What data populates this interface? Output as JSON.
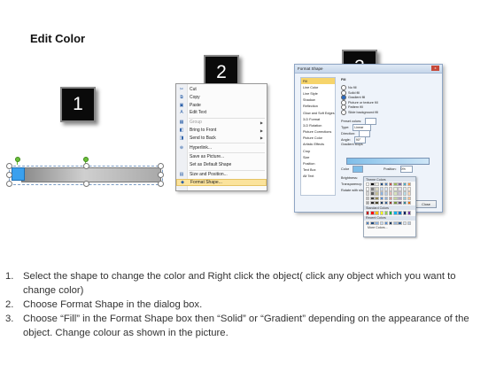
{
  "title": "Edit Color",
  "badges": [
    "1",
    "2",
    "3"
  ],
  "context_menu": {
    "items": [
      {
        "label": "Cut",
        "icon": "cut-icon",
        "glyph": "✂",
        "disabled": false,
        "submenu": false
      },
      {
        "label": "Copy",
        "icon": "copy-icon",
        "glyph": "⧉",
        "disabled": false,
        "submenu": false
      },
      {
        "label": "Paste",
        "icon": "paste-icon",
        "glyph": "▣",
        "disabled": false,
        "submenu": false
      },
      {
        "label": "Edit Text",
        "icon": "edit-text-icon",
        "glyph": "A",
        "disabled": false,
        "submenu": false
      },
      {
        "label": "Group",
        "icon": "group-icon",
        "glyph": "▦",
        "disabled": true,
        "submenu": true
      },
      {
        "label": "Bring to Front",
        "icon": "bring-to-front-icon",
        "glyph": "◧",
        "disabled": false,
        "submenu": true
      },
      {
        "label": "Send to Back",
        "icon": "send-to-back-icon",
        "glyph": "◨",
        "disabled": false,
        "submenu": true
      },
      {
        "label": "Hyperlink...",
        "icon": "hyperlink-icon",
        "glyph": "⊕",
        "disabled": false,
        "submenu": false
      },
      {
        "label": "Save as Picture...",
        "icon": "",
        "glyph": "",
        "disabled": false,
        "submenu": false
      },
      {
        "label": "Set as Default Shape",
        "icon": "",
        "glyph": "",
        "disabled": false,
        "submenu": false
      },
      {
        "label": "Size and Position...",
        "icon": "size-position-icon",
        "glyph": "▤",
        "disabled": false,
        "submenu": false
      },
      {
        "label": "Format Shape...",
        "icon": "format-shape-icon",
        "glyph": "◆",
        "disabled": false,
        "submenu": false,
        "highlighted": true
      }
    ]
  },
  "format_dialog": {
    "title": "Format Shape",
    "close": "x",
    "categories": [
      "Fill",
      "Line Color",
      "Line Style",
      "Shadow",
      "Reflection",
      "Glow and Soft Edges",
      "3-D Format",
      "3-D Rotation",
      "Picture Corrections",
      "Picture Color",
      "Artistic Effects",
      "Crop",
      "Size",
      "Position",
      "Text Box",
      "Alt Text"
    ],
    "selected_category": "Fill",
    "section_title": "Fill",
    "fill_options": [
      "No fill",
      "Solid fill",
      "Gradient fill",
      "Picture or texture fill",
      "Pattern fill",
      "Slide background fill"
    ],
    "selected_fill": "Gradient fill",
    "fields": [
      {
        "label": "Preset colors:"
      },
      {
        "label": "Type:",
        "value": "Linear"
      },
      {
        "label": "Direction:"
      },
      {
        "label": "Angle:",
        "value": "90°"
      },
      {
        "label": "Gradient stops"
      }
    ],
    "color_label": "Color",
    "position_label": "Position:",
    "position_value": "0%",
    "brightness_label": "Brightness:",
    "transparency_label": "Transparency:",
    "rotate_label": "Rotate with shape",
    "close_button": "Close"
  },
  "palette": {
    "theme_label": "Theme Colors",
    "standard_label": "Standard Colors",
    "recent_label": "Recent Colors",
    "more_label": "More Colors...",
    "theme_colors": [
      "#ffffff",
      "#000000",
      "#eeece1",
      "#1f497d",
      "#4f81bd",
      "#c0504d",
      "#9bbb59",
      "#8064a2",
      "#4bacc6",
      "#f79646",
      "#f2f2f2",
      "#7f7f7f",
      "#ddd9c3",
      "#c6d9f0",
      "#dbe5f1",
      "#f2dcdb",
      "#ebf1dd",
      "#e5e0ec",
      "#dbeef3",
      "#fdeada",
      "#d8d8d8",
      "#595959",
      "#c4bd97",
      "#8db3e2",
      "#b8cce4",
      "#e5b9b7",
      "#d7e3bc",
      "#ccc1d9",
      "#b7dde8",
      "#fbd5b5",
      "#bfbfbf",
      "#3f3f3f",
      "#938953",
      "#548dd4",
      "#95b3d7",
      "#d99694",
      "#c3d69b",
      "#b2a2c7",
      "#92cddc",
      "#fac08f",
      "#a5a5a5",
      "#262626",
      "#494429",
      "#17365d",
      "#366092",
      "#953734",
      "#76923c",
      "#5f497a",
      "#31859b",
      "#e36c09"
    ],
    "standard_colors": [
      "#c00000",
      "#ff0000",
      "#ffc000",
      "#ffff00",
      "#92d050",
      "#00b050",
      "#00b0f0",
      "#0070c0",
      "#002060",
      "#7030a0"
    ],
    "recent_colors": [
      "#4f81bd",
      "#1f497d",
      "#8db3e2",
      "#c6d9f0",
      "#548dd4",
      "#17365d",
      "#95b3d7",
      "#366092",
      "#dbe5f1",
      "#b8cce4"
    ]
  },
  "steps": [
    {
      "number": "1.",
      "text": "Select the shape to change the color and Right click the object( click any object which you want to change color)"
    },
    {
      "number": "2.",
      "text": "Choose Format Shape in the dialog box."
    },
    {
      "number": "3.",
      "text": "Choose “Fill” in the Format Shape box then “Solid” or “Gradient” depending on the appearance of the object. Change colour as shown in the picture."
    }
  ]
}
